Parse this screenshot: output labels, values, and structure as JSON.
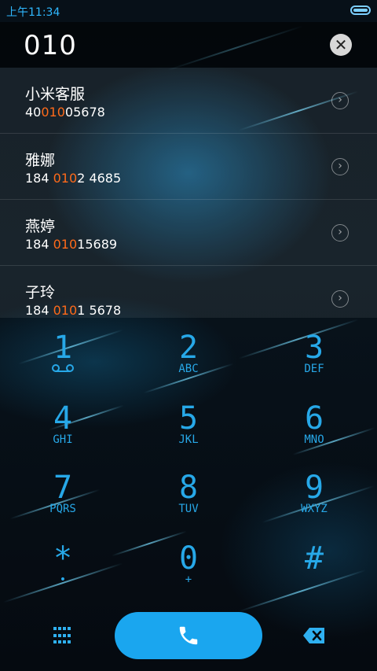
{
  "status_bar": {
    "time": "上午11:34"
  },
  "dialer": {
    "input_value": "010"
  },
  "results": [
    {
      "name": "小米客服",
      "number_pre": "40",
      "number_hl": "010",
      "number_post": "05678"
    },
    {
      "name": "雅娜",
      "number_pre": "184 ",
      "number_hl": "010",
      "number_post": "2 4685"
    },
    {
      "name": "燕婷",
      "number_pre": "184 ",
      "number_hl": "010",
      "number_post": "15689"
    },
    {
      "name": "子玲",
      "number_pre": "184 ",
      "number_hl": "010",
      "number_post": "1 5678"
    }
  ],
  "keypad": [
    {
      "digit": "1",
      "letters": ""
    },
    {
      "digit": "2",
      "letters": "ABC"
    },
    {
      "digit": "3",
      "letters": "DEF"
    },
    {
      "digit": "4",
      "letters": "GHI"
    },
    {
      "digit": "5",
      "letters": "JKL"
    },
    {
      "digit": "6",
      "letters": "MNO"
    },
    {
      "digit": "7",
      "letters": "PQRS"
    },
    {
      "digit": "8",
      "letters": "TUV"
    },
    {
      "digit": "9",
      "letters": "WXYZ"
    },
    {
      "digit": "*",
      "letters": "•"
    },
    {
      "digit": "0",
      "letters": "+"
    },
    {
      "digit": "#",
      "letters": ""
    }
  ],
  "colors": {
    "accent": "#27a8e8",
    "highlight": "#ff6a1a",
    "call_button": "#1aa6ef"
  },
  "icons": {
    "clear": "close-icon",
    "voicemail": "voicemail-icon",
    "keypad_toggle": "grid-icon",
    "call": "phone-icon",
    "backspace": "backspace-icon",
    "chevron": "chevron-right-icon"
  }
}
